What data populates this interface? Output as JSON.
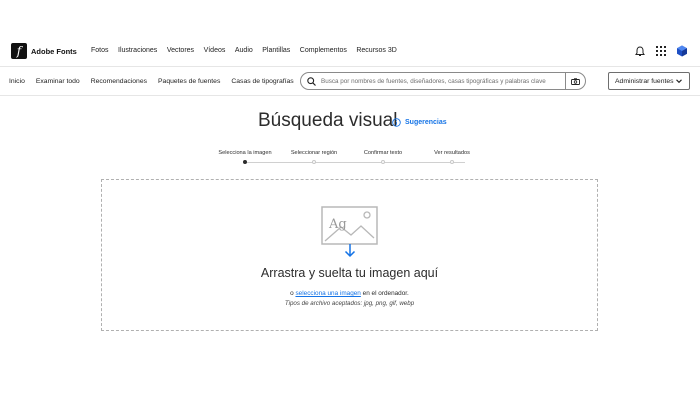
{
  "brand": {
    "logo_glyph": "f",
    "name": "Adobe Fonts"
  },
  "top_nav": [
    "Fotos",
    "Ilustraciones",
    "Vectores",
    "Vídeos",
    "Audio",
    "Plantillas",
    "Complementos",
    "Recursos 3D"
  ],
  "top_icons": [
    "bell-icon",
    "apps-grid-icon",
    "profile-cube-icon"
  ],
  "sub_nav": [
    "Inicio",
    "Examinar todo",
    "Recomendaciones",
    "Paquetes de fuentes",
    "Casas de tipografías"
  ],
  "search": {
    "placeholder": "Busca por nombres de fuentes, diseñadores, casas tipográficas y palabras clave"
  },
  "manage": {
    "label": "Administrar fuentes"
  },
  "main": {
    "title": "Búsqueda visual",
    "suggestions": "Sugerencias"
  },
  "steps": [
    {
      "label": "Selecciona la imagen",
      "active": true
    },
    {
      "label": "Seleccionar región",
      "active": false
    },
    {
      "label": "Confirmar texto",
      "active": false
    },
    {
      "label": "Ver resultados",
      "active": false
    }
  ],
  "dropzone": {
    "icon_text": "Ag",
    "title": "Arrastra y suelta tu imagen aquí",
    "prefix": "o",
    "link": "selecciona una imagen",
    "suffix": "en el ordenador.",
    "formats": "Tipos de archivo aceptados: jpg, png, gif, webp"
  },
  "colors": {
    "accent": "#1473e6",
    "text": "#2c2c2c",
    "border": "#b0b0b0"
  }
}
